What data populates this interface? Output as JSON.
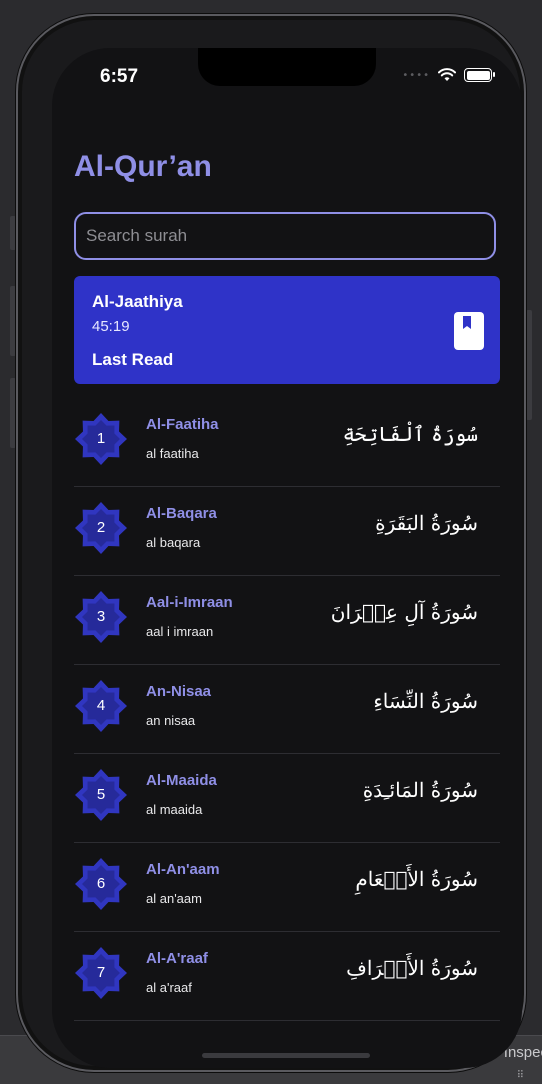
{
  "status_bar": {
    "time": "6:57",
    "signal": "••••"
  },
  "app": {
    "title": "Al-Qur’an"
  },
  "search": {
    "placeholder": "Search surah",
    "value": ""
  },
  "last_read": {
    "surah": "Al-Jaathiya",
    "ayah": "45:19",
    "label": "Last Read",
    "icon": "bookmark-book-icon"
  },
  "surahs": [
    {
      "number": "1",
      "name": "Al-Faatiha",
      "translit": "al faatiha",
      "arabic": "سُورَةُ ٱلْفَاتِحَةِ"
    },
    {
      "number": "2",
      "name": "Al-Baqara",
      "translit": "al baqara",
      "arabic": "سُورَةُ البَقَرَةِ"
    },
    {
      "number": "3",
      "name": "Aal-i-Imraan",
      "translit": "aal i imraan",
      "arabic": "سُورَةُ آلِ عِمۡرَانَ"
    },
    {
      "number": "4",
      "name": "An-Nisaa",
      "translit": "an nisaa",
      "arabic": "سُورَةُ النِّسَاءِ"
    },
    {
      "number": "5",
      "name": "Al-Maaida",
      "translit": "al maaida",
      "arabic": "سُورَةُ المَائـِدَةِ"
    },
    {
      "number": "6",
      "name": "Al-An'aam",
      "translit": "al an'aam",
      "arabic": "سُورَةُ الأَنۡعَامِ"
    },
    {
      "number": "7",
      "name": "Al-A'raaf",
      "translit": "al a'raaf",
      "arabic": "سُورَةُ الأَعۡرَافِ"
    }
  ],
  "inspector": {
    "label": "Inspec"
  },
  "colors": {
    "accent": "#8f8fe6",
    "card": "#2f33c8",
    "background": "#121214",
    "star": "#3036c0"
  }
}
